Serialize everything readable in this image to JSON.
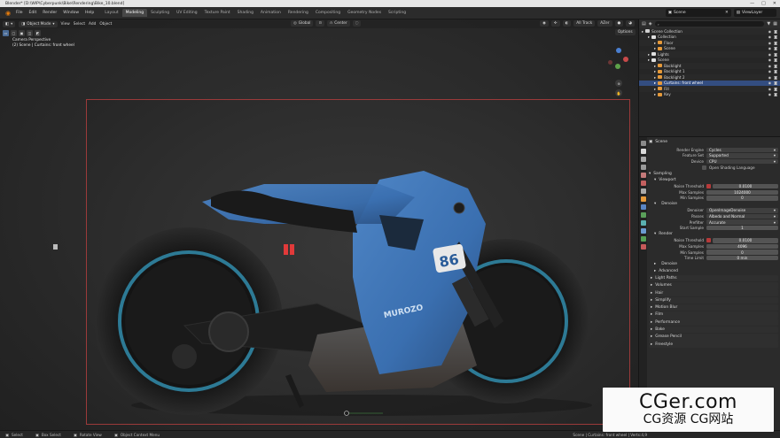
{
  "window": {
    "title": "Blender* [D:\\WIP\\Cyberpunk\\Bike\\Rendering\\Bike_10.blend]",
    "controls": [
      "—",
      "□",
      "✕"
    ]
  },
  "topbar": {
    "menu": [
      "File",
      "Edit",
      "Render",
      "Window",
      "Help"
    ],
    "tabs": [
      "Layout",
      "Modeling",
      "Sculpting",
      "UV Editing",
      "Texture Paint",
      "Shading",
      "Animation",
      "Rendering",
      "Compositing",
      "Geometry Nodes",
      "Scripting"
    ],
    "active_tab": "Modeling",
    "scene": "Scene",
    "view_layer": "ViewLayer"
  },
  "viewport": {
    "mode": "Object Mode",
    "menus": [
      "View",
      "Select",
      "Add",
      "Object"
    ],
    "pivot": "Global",
    "snap": "Center",
    "options": "Options",
    "overlay_line1": "Camera Perspective",
    "overlay_line2": "(2) Scene | Curtains: front wheel",
    "overlays": [
      "All Track",
      "AZer"
    ]
  },
  "outliner": {
    "title": "Scene Collection",
    "rows": [
      {
        "label": "Scene Collection",
        "indent": 0,
        "icon": "#d0d0d0",
        "selected": false
      },
      {
        "label": "Collection",
        "indent": 1,
        "icon": "#e0e0e0",
        "selected": false
      },
      {
        "label": "Floor",
        "indent": 2,
        "icon": "#e69a3a",
        "selected": false
      },
      {
        "label": "Scene",
        "indent": 2,
        "icon": "#e69a3a",
        "selected": false
      },
      {
        "label": "Lights",
        "indent": 1,
        "icon": "#e0e0e0",
        "selected": false
      },
      {
        "label": "Scene",
        "indent": 1,
        "icon": "#e0e0e0",
        "selected": false
      },
      {
        "label": "Backlight",
        "indent": 2,
        "icon": "#e69a3a",
        "selected": false
      },
      {
        "label": "Backlight 1",
        "indent": 2,
        "icon": "#e69a3a",
        "selected": false
      },
      {
        "label": "Backlight 2",
        "indent": 2,
        "icon": "#e69a3a",
        "selected": false
      },
      {
        "label": "Curtains: front wheel",
        "indent": 2,
        "icon": "#e69a3a",
        "selected": true
      },
      {
        "label": "Fill",
        "indent": 2,
        "icon": "#e69a3a",
        "selected": false
      },
      {
        "label": "Key",
        "indent": 2,
        "icon": "#e69a3a",
        "selected": false
      }
    ]
  },
  "properties": {
    "header": "Scene",
    "render_engine_label": "Render Engine",
    "render_engine": "Cycles",
    "feature_set_label": "Feature Set",
    "feature_set": "Supported",
    "device_label": "Device",
    "device": "CPU",
    "osl": "Open Shading Language",
    "sampling": "Sampling",
    "viewport": "Viewport",
    "noise_threshold_label": "Noise Threshold",
    "vp_noise_threshold": "0.0100",
    "max_samples_label": "Max Samples",
    "vp_max_samples": "1024000",
    "min_samples_label": "Min Samples",
    "vp_min_samples": "0",
    "denoise": "Denoise",
    "denoiser_label": "Denoiser",
    "denoiser": "OpenImageDenoise",
    "passes_label": "Passes",
    "passes": "Albedo and Normal",
    "prefilter_label": "Prefilter",
    "prefilter": "Accurate",
    "start_sample_label": "Start Sample",
    "start_sample": "1",
    "render": "Render",
    "r_noise_threshold": "0.0100",
    "r_max_samples": "4096",
    "r_min_samples": "0",
    "time_limit_label": "Time Limit",
    "time_limit": "0 min",
    "r_denoise": "Denoise",
    "advanced": "Advanced",
    "collapsed": [
      "Light Paths",
      "Volumes",
      "Hair",
      "Simplify",
      "Motion Blur",
      "Film",
      "Performance",
      "Bake",
      "Grease Pencil",
      "Freestyle"
    ]
  },
  "statusbar": {
    "select": "Select",
    "box_select": "Box Select",
    "rotate": "Rotate View",
    "context": "Object Context Menu",
    "right_text": "Scene | Curtains: front wheel | Verts:4,9"
  },
  "watermark": {
    "line1": "CGer.com",
    "line2": "CG资源 CG网站"
  }
}
